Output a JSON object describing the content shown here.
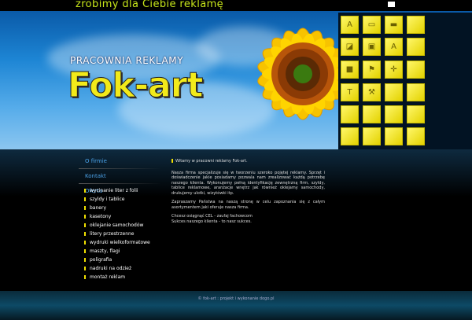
{
  "header": {
    "slogan": "zrobimy dla Ciebie reklamę",
    "studio": "PRACOWNIA REKLAMY",
    "logo": "Fok-art"
  },
  "nav": {
    "items": [
      "O firmie",
      "Kontakt",
      "Oferta"
    ],
    "sub_items": [
      "wycinanie liter z folii",
      "szyldy i tablice",
      "banery",
      "kasetony",
      "oklejanie samochodów",
      "litery przestrzenne",
      "wydruki wielkoformatowe",
      "maszty, flagi",
      "poligrafia",
      "nadruki na odzież",
      "montaż reklam"
    ]
  },
  "content": {
    "welcome": "Witamy w pracowni reklamy Fok-art.",
    "para1": "Nasza firma specjalizuje się w tworzeniu szeroko pojętej reklamy. Sprzęt i doświadczenie jakie posiadamy pozwala nam zrealizować każdą potrzebę naszego klienta. Wykonujemy pełną identyfikację zewnętrzną firm, szyldy, tablice reklamowe, aranżacje wnętrz jak również oklejamy samochody, drukujemy ulotki, wizytówki itp.",
    "para2": "Zapraszamy Państwa na naszą stronę w celu zapoznania się z całym asortymentem jaki oferuje nasza firma.",
    "para3": "Chcesz osiągnąć CEL - zaufaj fachowcom",
    "para4": "Sukces naszego klienta - to nasz sukces."
  },
  "footer": {
    "text": "© fok-art : projekt i wykonanie dogo.pl"
  },
  "colors": {
    "accent_yellow": "#f0e000",
    "nav_blue": "#4aa0e6",
    "slogan_green": "#c8e61a"
  }
}
